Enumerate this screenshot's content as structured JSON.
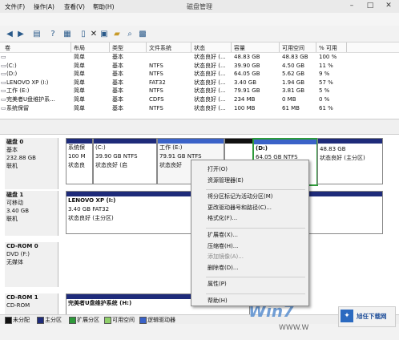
{
  "window": {
    "title": "磁盘管理"
  },
  "menu": [
    "文件(F)",
    "操作(A)",
    "查看(V)",
    "帮助(H)"
  ],
  "toolbar_icons": [
    "back-icon",
    "forward-icon",
    "up-icon",
    "help-icon",
    "properties-icon",
    "close-icon",
    "copy-icon",
    "open-icon",
    "search-icon",
    "zoom-icon"
  ],
  "volume_table": {
    "columns": [
      "卷",
      "布局",
      "类型",
      "文件系统",
      "状态",
      "容量",
      "可用空间",
      "% 可用"
    ],
    "rows": [
      [
        "",
        "简单",
        "基本",
        "",
        "状态良好 (...",
        "48.83 GB",
        "48.83 GB",
        "100 %"
      ],
      [
        "(C:)",
        "简单",
        "基本",
        "NTFS",
        "状态良好 (...",
        "39.90 GB",
        "4.50 GB",
        "11 %"
      ],
      [
        "(D:)",
        "简单",
        "基本",
        "NTFS",
        "状态良好 (...",
        "64.05 GB",
        "5.62 GB",
        "9 %"
      ],
      [
        "LENOVO XP (I:)",
        "简单",
        "基本",
        "FAT32",
        "状态良好 (...",
        "3.40 GB",
        "1.94 GB",
        "57 %"
      ],
      [
        "工作 (E:)",
        "简单",
        "基本",
        "NTFS",
        "状态良好 (...",
        "79.91 GB",
        "3.81 GB",
        "5 %"
      ],
      [
        "完美者U盘维护系...",
        "简单",
        "基本",
        "CDFS",
        "状态良好 (...",
        "234 MB",
        "0 MB",
        "0 %"
      ],
      [
        "系统保留",
        "简单",
        "基本",
        "NTFS",
        "状态良好 (...",
        "100 MB",
        "61 MB",
        "61 %"
      ]
    ]
  },
  "disks": [
    {
      "name": "磁盘 0",
      "lines": [
        "基本",
        "232.88 GB",
        "联机"
      ],
      "partitions": [
        {
          "label": "系统保",
          "lines": [
            "100 M",
            "状态良"
          ]
        },
        {
          "label": "(C:)",
          "lines": [
            "39.90 GB NTFS",
            "状态良好 (启"
          ]
        },
        {
          "label": "工作 (E:)",
          "lines": [
            "79.91 GB NTFS",
            "状态良好"
          ]
        },
        {
          "label": "",
          "lines": [
            ""
          ]
        },
        {
          "label": "(D:)",
          "lines": [
            "64.05 GB NTFS",
            ""
          ]
        },
        {
          "label": "",
          "lines": [
            "48.83 GB",
            "状态良好 (主分区)"
          ]
        }
      ]
    },
    {
      "name": "磁盘 1",
      "lines": [
        "可移动",
        "3.40 GB",
        "联机"
      ],
      "partitions": [
        {
          "label": "LENOVO XP (I:)",
          "lines": [
            "3.40 GB FAT32",
            "状态良好 (主分区)"
          ]
        }
      ]
    },
    {
      "name": "CD-ROM 0",
      "lines": [
        "DVD (F:)",
        "",
        "无媒体"
      ],
      "partitions": []
    },
    {
      "name": "CD-ROM 1",
      "lines": [
        "CD-ROM"
      ],
      "partitions": [
        {
          "label": "完美者U盘维护系统 (H:)",
          "lines": []
        }
      ]
    }
  ],
  "context_menu": {
    "items": [
      {
        "label": "打开(O)",
        "enabled": true
      },
      {
        "label": "资源管理器(E)",
        "enabled": true
      },
      {
        "sep": true
      },
      {
        "label": "将分区标记为活动分区(M)",
        "enabled": true
      },
      {
        "label": "更改驱动器号和路径(C)...",
        "enabled": true
      },
      {
        "label": "格式化(F)...",
        "enabled": true
      },
      {
        "sep": true
      },
      {
        "label": "扩展卷(X)...",
        "enabled": true
      },
      {
        "label": "压缩卷(H)...",
        "enabled": true
      },
      {
        "label": "添加镜像(A)...",
        "enabled": false
      },
      {
        "label": "删除卷(D)...",
        "enabled": true
      },
      {
        "sep": true
      },
      {
        "label": "属性(P)",
        "enabled": true
      },
      {
        "sep": true
      },
      {
        "label": "帮助(H)",
        "enabled": true
      }
    ]
  },
  "legend": [
    {
      "label": "未分配",
      "color": "#111111"
    },
    {
      "label": "主分区",
      "color": "#1e2b7a"
    },
    {
      "label": "扩展分区",
      "color": "#2e9a3a"
    },
    {
      "label": "可用空间",
      "color": "#8fcf6a"
    },
    {
      "label": "逻辑驱动器",
      "color": "#3a62c8"
    }
  ],
  "watermark": {
    "brand": "Win7",
    "site_name": "WWW.W",
    "corner_text": "旭任下载网"
  }
}
